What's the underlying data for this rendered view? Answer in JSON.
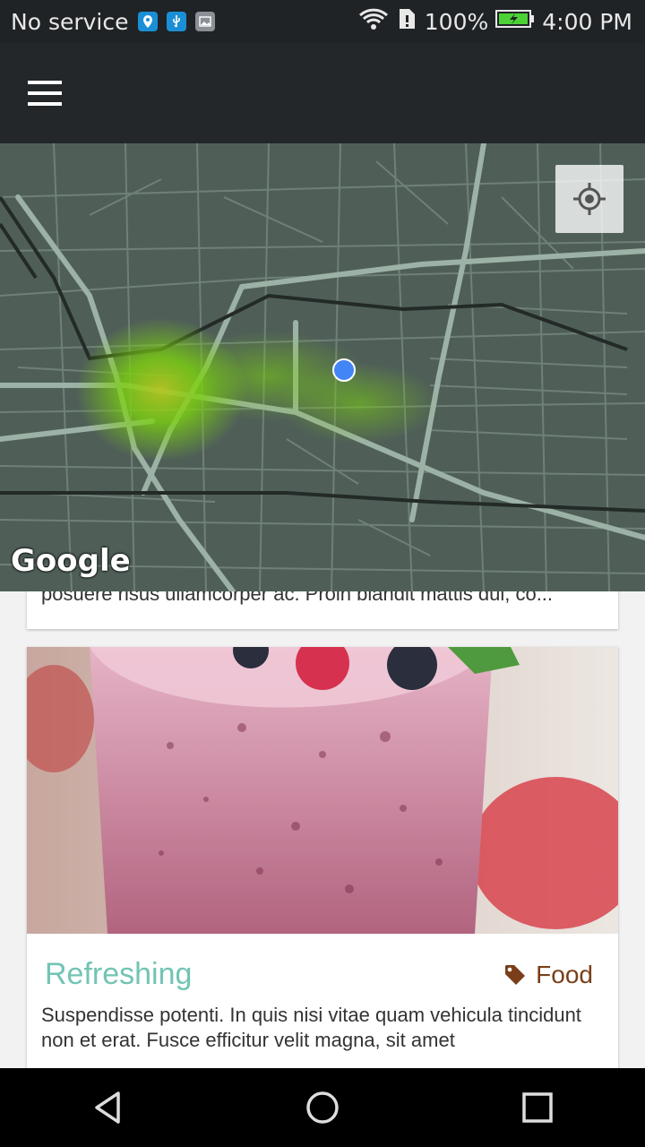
{
  "status_bar": {
    "carrier": "No service",
    "battery": "100%",
    "time": "4:00 PM",
    "icons": [
      "location-icon",
      "usb-icon",
      "image-icon",
      "wifi-icon",
      "sim-alert-icon",
      "battery-charging-icon"
    ]
  },
  "app_bar": {
    "menu_icon": "hamburger-menu-icon"
  },
  "map": {
    "attribution": "Google",
    "locate_icon": "my-location-icon",
    "heat_color": "#7bd10f",
    "user_dot_color": "#4285f4"
  },
  "feed": {
    "previous_card_text": "posuere risus ullamcorper ac. Proin blandit mattis dui, co...",
    "card": {
      "title": "Refreshing",
      "tag": "Food",
      "tag_icon": "tag-icon",
      "body": "Suspendisse potenti. In quis nisi vitae quam vehicula tincidunt non et erat. Fusce efficitur velit magna, sit amet"
    }
  },
  "nav_bar": {
    "icons": [
      "back-icon",
      "home-icon",
      "recents-icon"
    ]
  }
}
